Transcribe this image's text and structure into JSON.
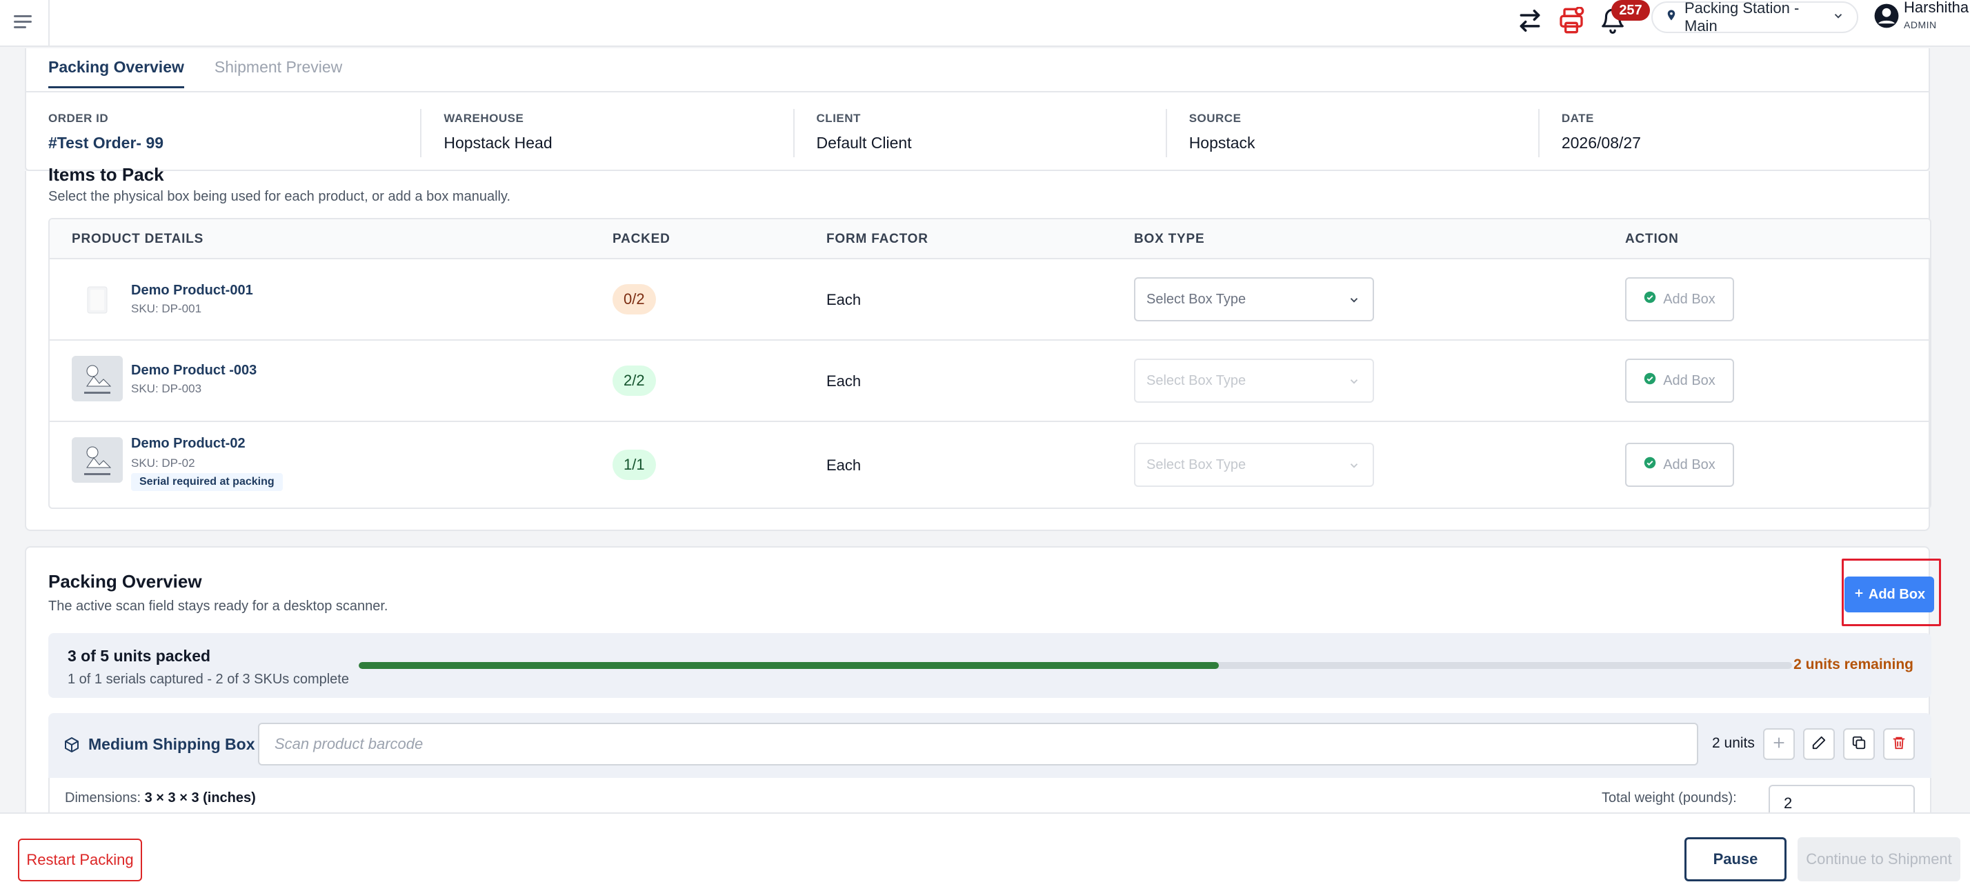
{
  "header": {
    "notification_count": "257",
    "station": "Packing Station - Main",
    "user_name": "Harshitha",
    "user_role": "ADMIN"
  },
  "tabs": [
    {
      "label": "Packing Overview",
      "active": true
    },
    {
      "label": "Shipment Preview",
      "active": false
    }
  ],
  "order_meta": [
    {
      "label": "ORDER ID",
      "value": "#Test Order- 99"
    },
    {
      "label": "WAREHOUSE",
      "value": "Hopstack Head"
    },
    {
      "label": "CLIENT",
      "value": "Default Client"
    },
    {
      "label": "SOURCE",
      "value": "Hopstack"
    },
    {
      "label": "DATE",
      "value": "2026/08/27"
    }
  ],
  "items": {
    "title": "Items to Pack",
    "subtitle": "Select the physical box being used for each product, or add a box manually.",
    "columns": [
      "PRODUCT DETAILS",
      "PACKED",
      "FORM FACTOR",
      "BOX TYPE",
      "ACTION"
    ],
    "rows": [
      {
        "name": "Demo Product-001",
        "sku": "SKU: DP-001",
        "packed": "0/2",
        "form_factor": "Each",
        "box_type_placeholder": "Select Box Type",
        "action": "Add Box",
        "serial_note": ""
      },
      {
        "name": "Demo Product -003",
        "sku": "SKU: DP-003",
        "packed": "2/2",
        "form_factor": "Each",
        "box_type_placeholder": "Select Box Type",
        "action": "Add Box",
        "serial_note": ""
      },
      {
        "name": "Demo Product-02",
        "sku": "SKU: DP-02",
        "packed": "1/1",
        "form_factor": "Each",
        "box_type_placeholder": "Select Box Type",
        "action": "Add Box",
        "serial_note": "Serial required at packing"
      }
    ]
  },
  "packing": {
    "title": "Packing Overview",
    "subtitle": "The active scan field stays ready for a desktop scanner.",
    "add_box_label": "Add Box",
    "progress_title": "3 of 5 units packed",
    "progress_sub": "1 of 1 serials captured - 2 of 3 SKUs complete",
    "progress_fraction": 0.6,
    "remaining": "2 units remaining",
    "box": {
      "name": "Medium Shipping Box",
      "scan_placeholder": "Scan product barcode",
      "units": "2 units",
      "dims_label": "Dimensions:",
      "dims_value": "3 × 3 × 3 (inches)",
      "weight_label": "Total weight (pounds):",
      "weight_value": "2"
    }
  },
  "footer": {
    "restart": "Restart Packing",
    "pause": "Pause",
    "continue": "Continue to Shipment"
  },
  "colors": {
    "primary": "#1e3a5f",
    "accent_blue": "#3b82f6",
    "danger": "#dc2626",
    "success": "#2f7d3b",
    "warning": "#b45309"
  }
}
